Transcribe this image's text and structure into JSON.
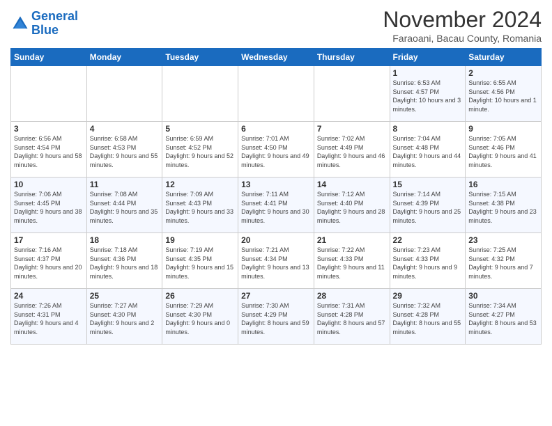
{
  "header": {
    "logo_line1": "General",
    "logo_line2": "Blue",
    "month": "November 2024",
    "location": "Faraoani, Bacau County, Romania"
  },
  "days_of_week": [
    "Sunday",
    "Monday",
    "Tuesday",
    "Wednesday",
    "Thursday",
    "Friday",
    "Saturday"
  ],
  "weeks": [
    [
      {
        "day": "",
        "info": ""
      },
      {
        "day": "",
        "info": ""
      },
      {
        "day": "",
        "info": ""
      },
      {
        "day": "",
        "info": ""
      },
      {
        "day": "",
        "info": ""
      },
      {
        "day": "1",
        "info": "Sunrise: 6:53 AM\nSunset: 4:57 PM\nDaylight: 10 hours and 3 minutes."
      },
      {
        "day": "2",
        "info": "Sunrise: 6:55 AM\nSunset: 4:56 PM\nDaylight: 10 hours and 1 minute."
      }
    ],
    [
      {
        "day": "3",
        "info": "Sunrise: 6:56 AM\nSunset: 4:54 PM\nDaylight: 9 hours and 58 minutes."
      },
      {
        "day": "4",
        "info": "Sunrise: 6:58 AM\nSunset: 4:53 PM\nDaylight: 9 hours and 55 minutes."
      },
      {
        "day": "5",
        "info": "Sunrise: 6:59 AM\nSunset: 4:52 PM\nDaylight: 9 hours and 52 minutes."
      },
      {
        "day": "6",
        "info": "Sunrise: 7:01 AM\nSunset: 4:50 PM\nDaylight: 9 hours and 49 minutes."
      },
      {
        "day": "7",
        "info": "Sunrise: 7:02 AM\nSunset: 4:49 PM\nDaylight: 9 hours and 46 minutes."
      },
      {
        "day": "8",
        "info": "Sunrise: 7:04 AM\nSunset: 4:48 PM\nDaylight: 9 hours and 44 minutes."
      },
      {
        "day": "9",
        "info": "Sunrise: 7:05 AM\nSunset: 4:46 PM\nDaylight: 9 hours and 41 minutes."
      }
    ],
    [
      {
        "day": "10",
        "info": "Sunrise: 7:06 AM\nSunset: 4:45 PM\nDaylight: 9 hours and 38 minutes."
      },
      {
        "day": "11",
        "info": "Sunrise: 7:08 AM\nSunset: 4:44 PM\nDaylight: 9 hours and 35 minutes."
      },
      {
        "day": "12",
        "info": "Sunrise: 7:09 AM\nSunset: 4:43 PM\nDaylight: 9 hours and 33 minutes."
      },
      {
        "day": "13",
        "info": "Sunrise: 7:11 AM\nSunset: 4:41 PM\nDaylight: 9 hours and 30 minutes."
      },
      {
        "day": "14",
        "info": "Sunrise: 7:12 AM\nSunset: 4:40 PM\nDaylight: 9 hours and 28 minutes."
      },
      {
        "day": "15",
        "info": "Sunrise: 7:14 AM\nSunset: 4:39 PM\nDaylight: 9 hours and 25 minutes."
      },
      {
        "day": "16",
        "info": "Sunrise: 7:15 AM\nSunset: 4:38 PM\nDaylight: 9 hours and 23 minutes."
      }
    ],
    [
      {
        "day": "17",
        "info": "Sunrise: 7:16 AM\nSunset: 4:37 PM\nDaylight: 9 hours and 20 minutes."
      },
      {
        "day": "18",
        "info": "Sunrise: 7:18 AM\nSunset: 4:36 PM\nDaylight: 9 hours and 18 minutes."
      },
      {
        "day": "19",
        "info": "Sunrise: 7:19 AM\nSunset: 4:35 PM\nDaylight: 9 hours and 15 minutes."
      },
      {
        "day": "20",
        "info": "Sunrise: 7:21 AM\nSunset: 4:34 PM\nDaylight: 9 hours and 13 minutes."
      },
      {
        "day": "21",
        "info": "Sunrise: 7:22 AM\nSunset: 4:33 PM\nDaylight: 9 hours and 11 minutes."
      },
      {
        "day": "22",
        "info": "Sunrise: 7:23 AM\nSunset: 4:33 PM\nDaylight: 9 hours and 9 minutes."
      },
      {
        "day": "23",
        "info": "Sunrise: 7:25 AM\nSunset: 4:32 PM\nDaylight: 9 hours and 7 minutes."
      }
    ],
    [
      {
        "day": "24",
        "info": "Sunrise: 7:26 AM\nSunset: 4:31 PM\nDaylight: 9 hours and 4 minutes."
      },
      {
        "day": "25",
        "info": "Sunrise: 7:27 AM\nSunset: 4:30 PM\nDaylight: 9 hours and 2 minutes."
      },
      {
        "day": "26",
        "info": "Sunrise: 7:29 AM\nSunset: 4:30 PM\nDaylight: 9 hours and 0 minutes."
      },
      {
        "day": "27",
        "info": "Sunrise: 7:30 AM\nSunset: 4:29 PM\nDaylight: 8 hours and 59 minutes."
      },
      {
        "day": "28",
        "info": "Sunrise: 7:31 AM\nSunset: 4:28 PM\nDaylight: 8 hours and 57 minutes."
      },
      {
        "day": "29",
        "info": "Sunrise: 7:32 AM\nSunset: 4:28 PM\nDaylight: 8 hours and 55 minutes."
      },
      {
        "day": "30",
        "info": "Sunrise: 7:34 AM\nSunset: 4:27 PM\nDaylight: 8 hours and 53 minutes."
      }
    ]
  ]
}
